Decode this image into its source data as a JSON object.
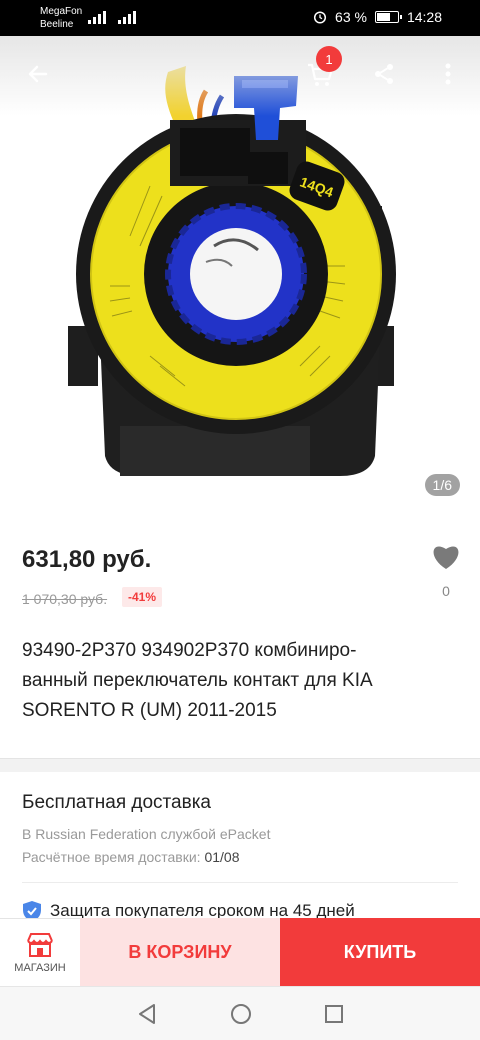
{
  "status_bar": {
    "carrier_1": "MegaFon",
    "carrier_2": "Beeline",
    "battery_percent": "63 %",
    "time": "14:28",
    "battery_level": 0.63
  },
  "top_bar": {
    "cart_badge": "1",
    "icons": [
      "back-arrow-icon",
      "cart-icon",
      "share-icon",
      "more-icon"
    ]
  },
  "gallery": {
    "counter": "1/6",
    "sticker_text": "14Q4"
  },
  "product": {
    "price": "631,80 руб.",
    "old_price": "1 070,30 руб.",
    "discount": "-41%",
    "favorites_count": "0",
    "title_line_1": "93490-2P370 934902P370 комбиниро-",
    "title_line_2": "ванный переключатель контакт для KIA",
    "title_line_3": "SORENTO R (UM) 2011-2015"
  },
  "shipping": {
    "title": "Бесплатная доставка",
    "method": "В Russian Federation службой ePacket",
    "eta_label": "Расчётное время доставки:",
    "eta_value": "01/08"
  },
  "protection": {
    "text": "Защита покупателя сроком на 45 дней"
  },
  "actions": {
    "store_label": "МАГАЗИН",
    "cart_label": "В КОРЗИНУ",
    "buy_label": "КУПИТЬ"
  },
  "colors": {
    "accent": "#f23b3b",
    "accent_light": "#fde2e2"
  }
}
